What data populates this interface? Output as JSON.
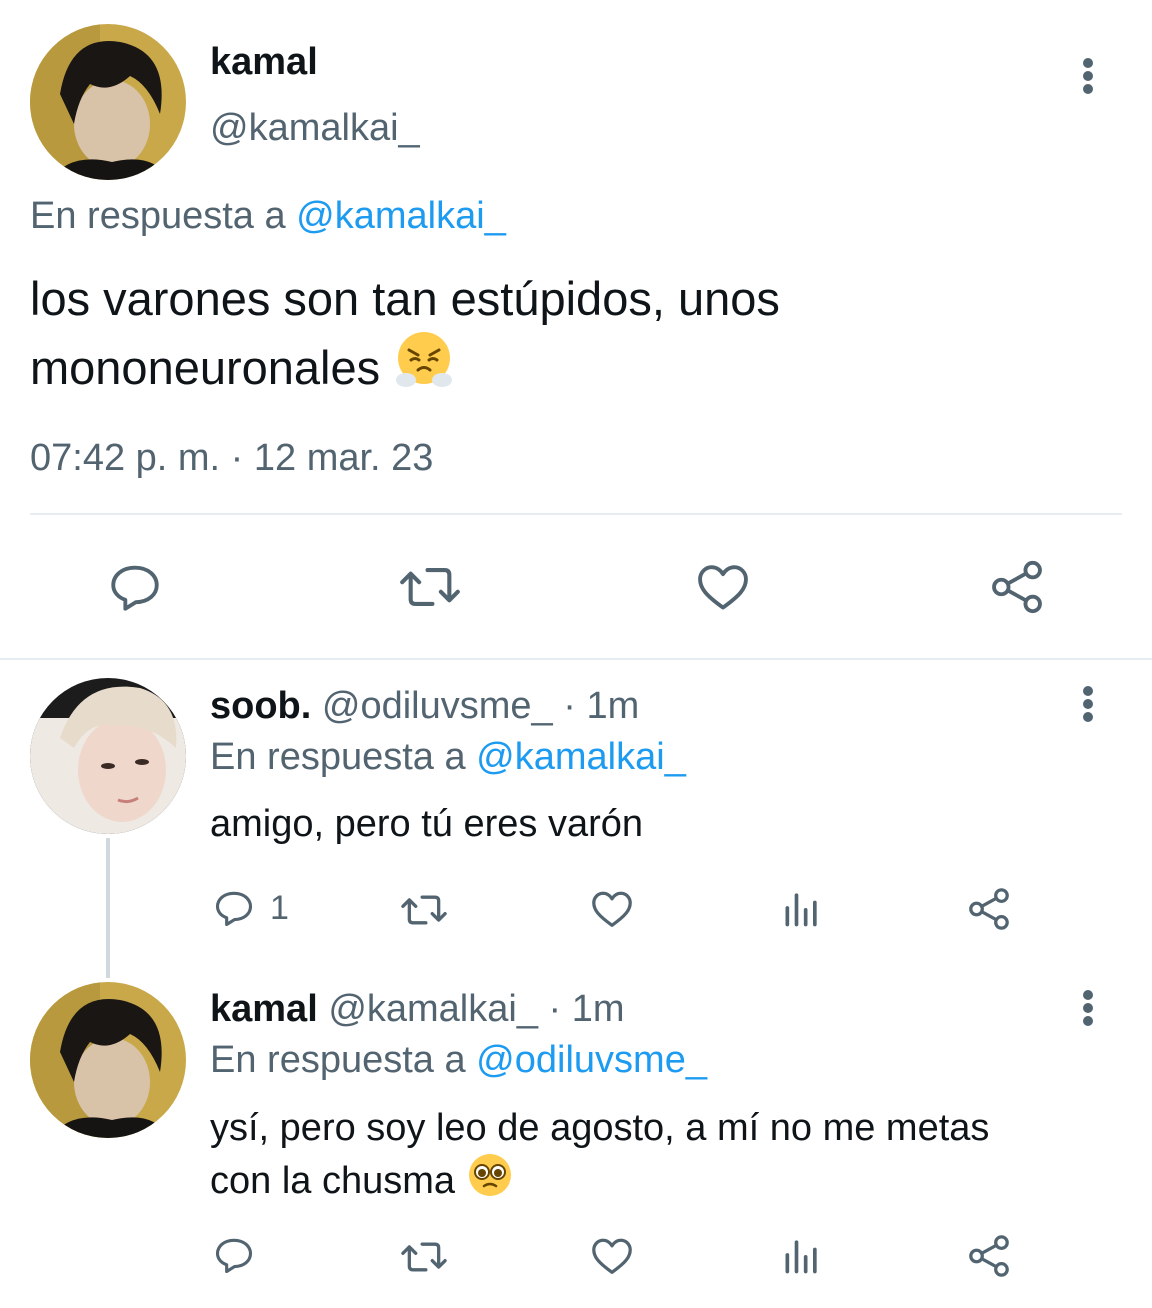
{
  "main_tweet": {
    "display_name": "kamal",
    "handle": "@kamalkai_",
    "reply_prefix": "En respuesta a",
    "reply_to": "@kamalkai_",
    "text_line1": "los varones son tan estúpidos, unos",
    "text_line2": "mononeuronales",
    "emoji": "face-with-steam-from-nose",
    "timestamp": "07:42 p. m. · 12 mar. 23",
    "actions": [
      "reply",
      "retweet",
      "like",
      "share"
    ]
  },
  "replies": [
    {
      "display_name": "soob.",
      "handle": "@odiluvsme_",
      "time": "· 1m",
      "reply_prefix": "En respuesta a",
      "reply_to": "@kamalkai_",
      "text": "amigo, pero tú eres varón",
      "reply_count": "1",
      "actions": [
        "reply",
        "retweet",
        "like",
        "views",
        "share"
      ]
    },
    {
      "display_name": "kamal",
      "handle": "@kamalkai_",
      "time": "· 1m",
      "reply_prefix": "En respuesta a",
      "reply_to": "@odiluvsme_",
      "text_line1": "ysí, pero soy leo de agosto, a mí no me metas",
      "text_line2": "con la chusma",
      "emoji": "pleading-face",
      "actions": [
        "reply",
        "retweet",
        "like",
        "views",
        "share"
      ]
    }
  ],
  "colors": {
    "text": "#0f1419",
    "muted": "#536471",
    "link": "#1d9bf0",
    "divider": "#e6ecf0"
  }
}
